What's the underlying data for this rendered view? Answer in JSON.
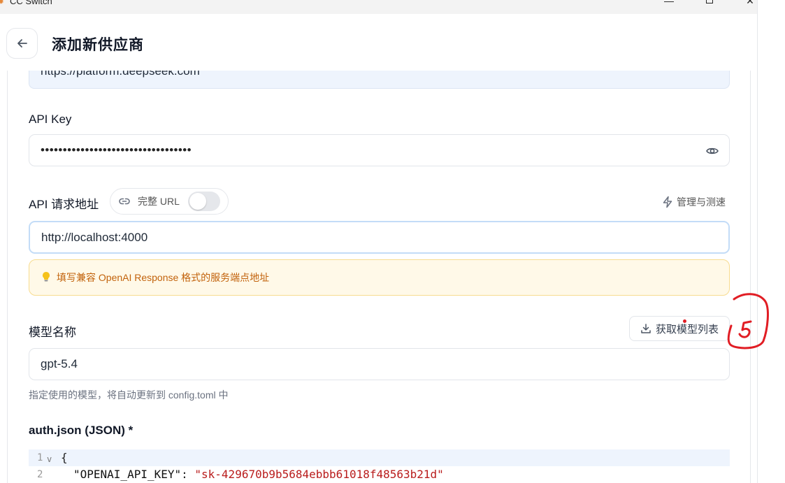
{
  "window": {
    "app_title": "CC Switch",
    "minimize_label": "—",
    "close_label": "✕"
  },
  "header": {
    "back_icon": "arrow-left-icon",
    "title": "添加新供应商"
  },
  "form": {
    "website_value": "https://platform.deepseek.com",
    "api_key": {
      "label": "API Key",
      "masked_value": "••••••••••••••••••••••••••••••••••"
    },
    "api_endpoint": {
      "label": "API 请求地址",
      "full_url_label": "完整 URL",
      "full_url_enabled": false,
      "manage_label": "管理与测速",
      "value": "http://localhost:4000",
      "hint": "填写兼容 OpenAI Response 格式的服务端点地址"
    },
    "model": {
      "label": "模型名称",
      "fetch_button": "获取模型列表",
      "value": "gpt-5.4",
      "helper": "指定使用的模型，将自动更新到 config.toml 中"
    },
    "auth_json": {
      "label": "auth.json (JSON) *",
      "lines": [
        {
          "number": "1",
          "text": "{"
        },
        {
          "number": "2",
          "key": "\"OPENAI_API_KEY\"",
          "sep": ": ",
          "value": "\"sk-429670b9b5684ebbb61018f48563b21d\""
        }
      ]
    }
  },
  "annotation": {
    "text": "5",
    "color": "#e11d24"
  },
  "colors": {
    "accent_focus": "#c3dcf7",
    "hint_bg": "#fff9e8",
    "hint_text": "#c2620b"
  }
}
